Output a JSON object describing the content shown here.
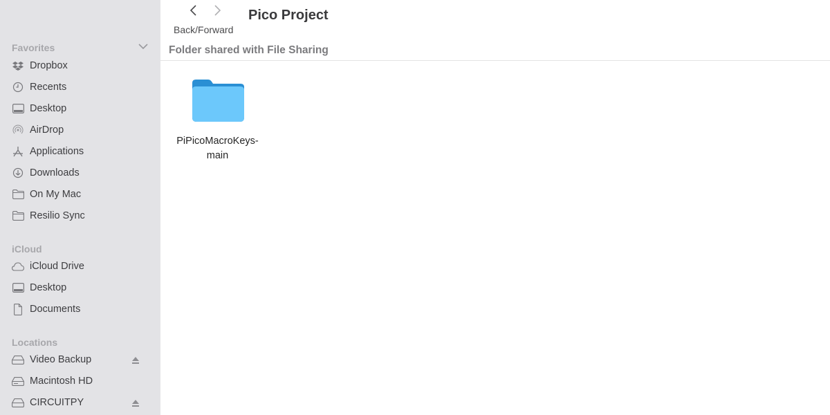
{
  "sidebar": {
    "favorites": {
      "header": "Favorites",
      "items": [
        {
          "label": "Dropbox",
          "icon": "dropbox-icon"
        },
        {
          "label": "Recents",
          "icon": "clock-icon"
        },
        {
          "label": "Desktop",
          "icon": "desktop-icon"
        },
        {
          "label": "AirDrop",
          "icon": "airdrop-icon"
        },
        {
          "label": "Applications",
          "icon": "applications-icon"
        },
        {
          "label": "Downloads",
          "icon": "download-icon"
        },
        {
          "label": "On My Mac",
          "icon": "folder-icon"
        },
        {
          "label": "Resilio Sync",
          "icon": "folder-icon"
        }
      ]
    },
    "icloud": {
      "header": "iCloud",
      "items": [
        {
          "label": "iCloud Drive",
          "icon": "cloud-icon"
        },
        {
          "label": "Desktop",
          "icon": "desktop-icon"
        },
        {
          "label": "Documents",
          "icon": "document-icon"
        }
      ]
    },
    "locations": {
      "header": "Locations",
      "items": [
        {
          "label": "Video Backup",
          "icon": "drive-icon",
          "ejectable": true
        },
        {
          "label": "Macintosh HD",
          "icon": "drive-icon",
          "ejectable": false
        },
        {
          "label": "CIRCUITPY",
          "icon": "drive-icon",
          "ejectable": true
        }
      ]
    }
  },
  "toolbar": {
    "nav_caption": "Back/Forward",
    "title": "Pico Project"
  },
  "main": {
    "subtitle": "Folder shared with File Sharing",
    "files": [
      {
        "name": "PiPicoMacroKeys-main",
        "type": "folder",
        "color": "#5ac8fa"
      }
    ]
  }
}
